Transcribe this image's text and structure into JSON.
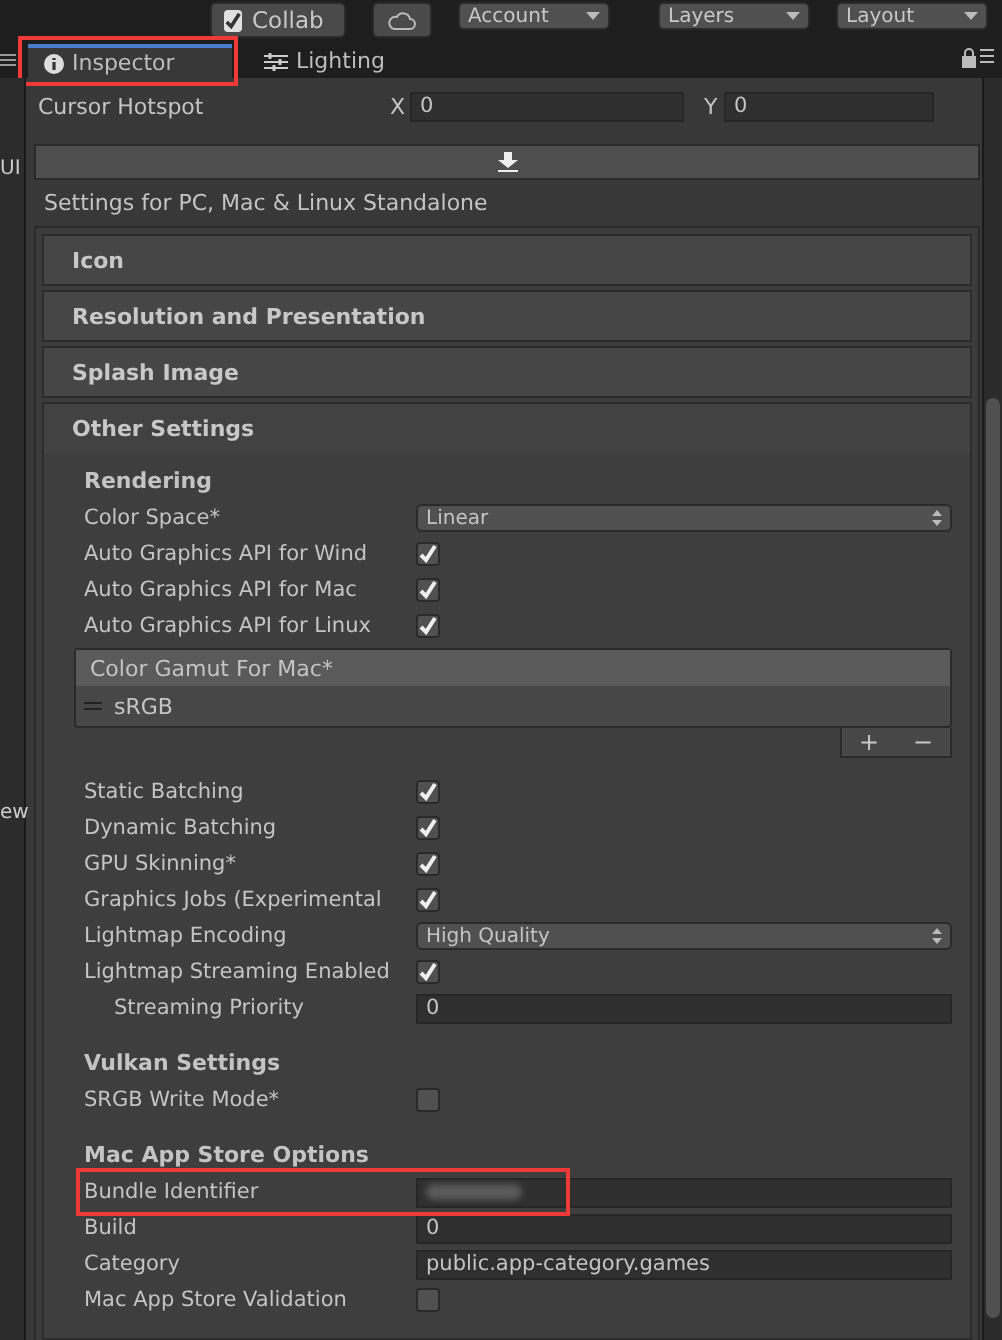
{
  "toolbar": {
    "buttons": [
      {
        "kind": "toggle",
        "label": "Collab",
        "checked": true
      },
      {
        "kind": "cloud"
      },
      {
        "kind": "dropdown",
        "label": "Account"
      },
      {
        "kind": "dropdown",
        "label": "Layers"
      },
      {
        "kind": "dropdown",
        "label": "Layout"
      }
    ]
  },
  "left_panel": {
    "texts": [
      "UI",
      "ew"
    ]
  },
  "tabs": [
    {
      "label": "Inspector",
      "selected": true,
      "highlighted": true
    },
    {
      "label": "Lighting",
      "selected": false,
      "highlighted": false
    }
  ],
  "cursor_hotspot": {
    "label": "Cursor Hotspot",
    "x_label": "X",
    "x_value": "0",
    "y_label": "Y",
    "y_value": "0"
  },
  "platform_title": "Settings for PC, Mac & Linux Standalone",
  "sections": [
    {
      "title": "Icon",
      "expanded": false
    },
    {
      "title": "Resolution and Presentation",
      "expanded": false
    },
    {
      "title": "Splash Image",
      "expanded": false
    },
    {
      "title": "Other Settings",
      "expanded": true
    }
  ],
  "groups": [
    {
      "title": "Rendering",
      "rows": [
        {
          "kind": "dropdown",
          "label": "Color Space*",
          "value": "Linear"
        },
        {
          "kind": "checkbox",
          "label": "Auto Graphics API  for Wind",
          "checked": true
        },
        {
          "kind": "checkbox",
          "label": "Auto Graphics API  for Mac",
          "checked": true
        },
        {
          "kind": "checkbox",
          "label": "Auto Graphics API  for Linux",
          "checked": true
        },
        {
          "kind": "list",
          "header": "Color Gamut For Mac*",
          "items": [
            "sRGB"
          ],
          "add": "+",
          "remove": "−"
        },
        {
          "kind": "checkbox",
          "label": "Static Batching",
          "checked": true
        },
        {
          "kind": "checkbox",
          "label": "Dynamic Batching",
          "checked": true
        },
        {
          "kind": "checkbox",
          "label": "GPU Skinning*",
          "checked": true
        },
        {
          "kind": "checkbox",
          "label": "Graphics Jobs (Experimental",
          "checked": true
        },
        {
          "kind": "dropdown",
          "label": "Lightmap Encoding",
          "value": "High Quality"
        },
        {
          "kind": "checkbox",
          "label": "Lightmap Streaming Enabled",
          "checked": true,
          "children": [
            {
              "kind": "field",
              "label": "Streaming Priority",
              "value": "0"
            }
          ]
        }
      ]
    },
    {
      "title": "Vulkan Settings",
      "rows": [
        {
          "kind": "checkbox",
          "label": "SRGB Write Mode*",
          "checked": false
        }
      ]
    },
    {
      "title": "Mac App Store Options",
      "rows": [
        {
          "kind": "redacted",
          "label": "Bundle Identifier",
          "highlighted": true
        },
        {
          "kind": "field",
          "label": "Build",
          "value": "0"
        },
        {
          "kind": "field",
          "label": "Category",
          "value": "public.app-category.games"
        },
        {
          "kind": "checkbox",
          "label": "Mac App Store Validation",
          "checked": false
        }
      ]
    }
  ]
}
